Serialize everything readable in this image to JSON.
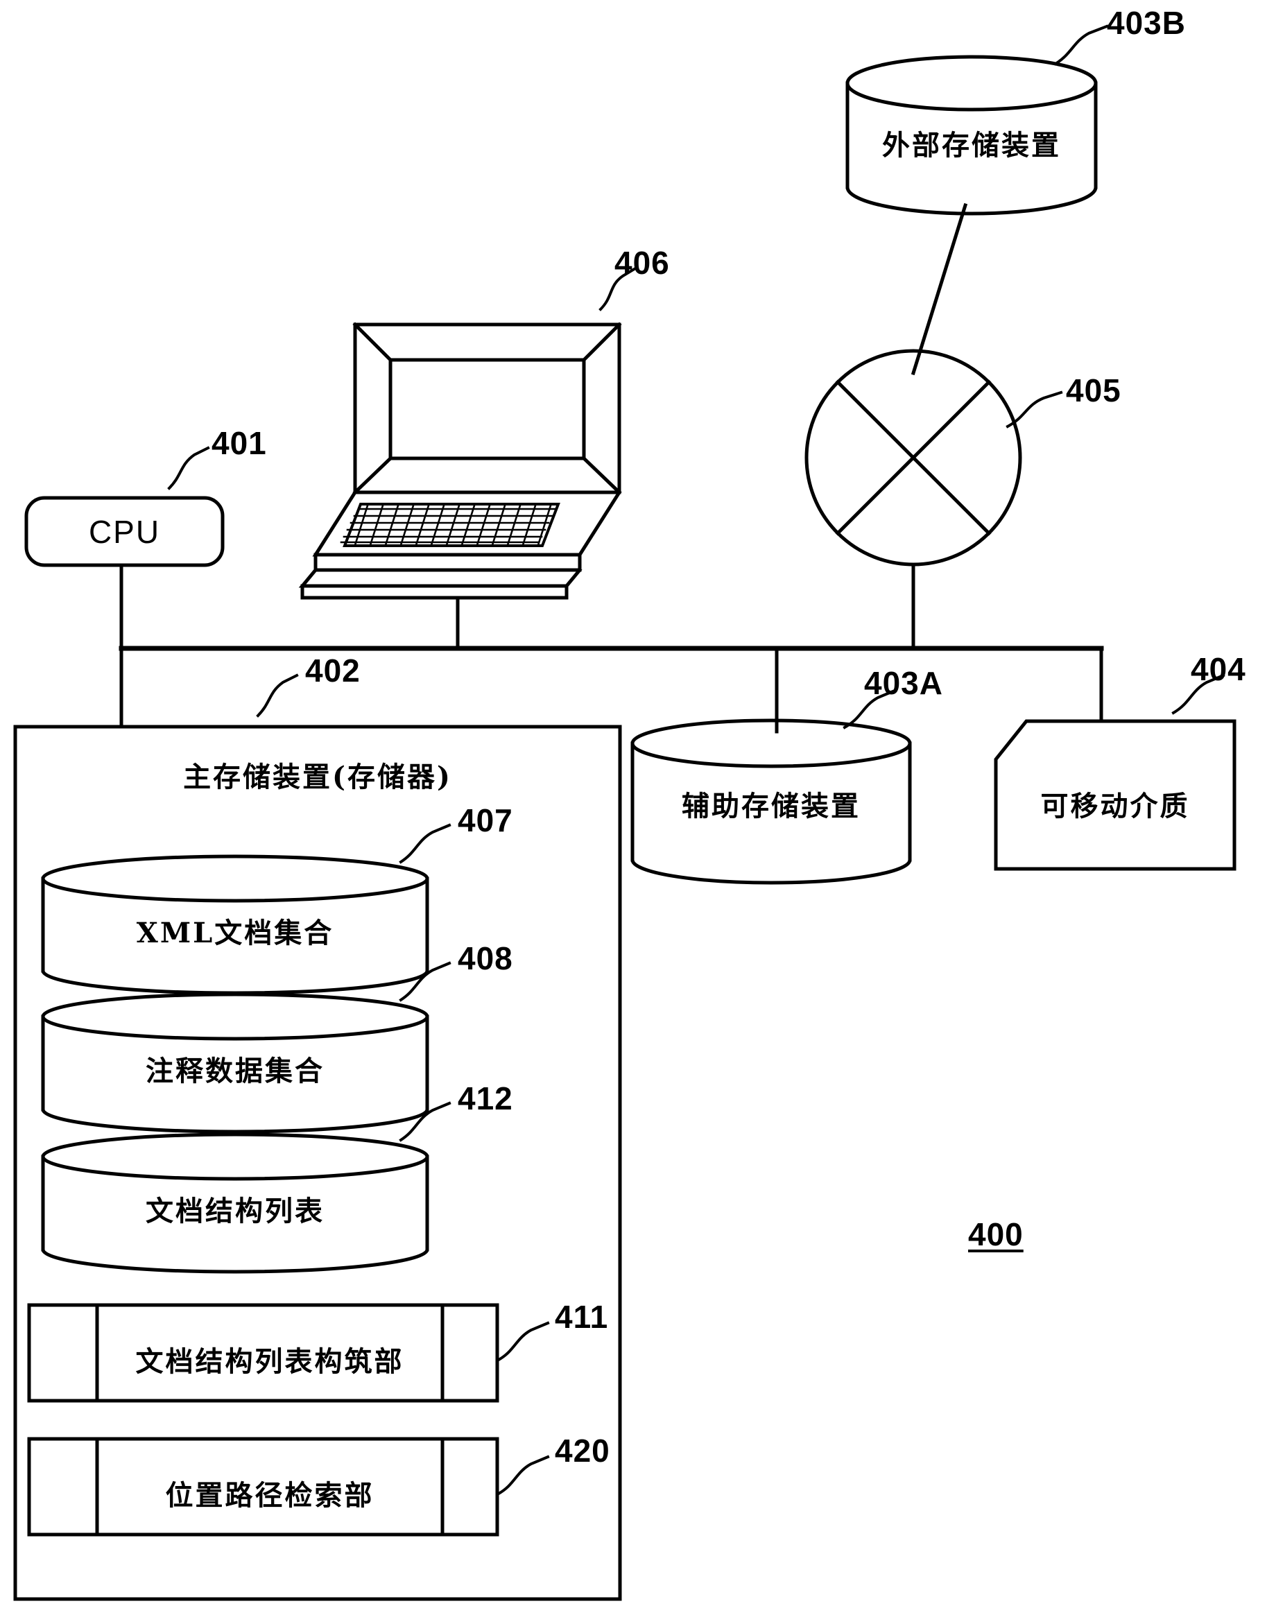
{
  "figure": {
    "number": "400",
    "title_note": "System configuration block diagram"
  },
  "components": {
    "cpu": {
      "label": "CPU",
      "ref": "401"
    },
    "laptop": {
      "ref": "406",
      "icon": "laptop-computer-icon"
    },
    "network": {
      "ref": "405",
      "icon": "circle-x-network-icon"
    },
    "external_storage": {
      "label": "外部存储装置",
      "ref": "403B",
      "icon": "cylinder-database-icon"
    },
    "main_storage": {
      "label": "主存储装置(存储器)",
      "ref": "402"
    },
    "auxiliary_storage": {
      "label": "辅助存储装置",
      "ref": "403A",
      "icon": "cylinder-database-icon"
    },
    "removable_media": {
      "label": "可移动介质",
      "ref": "404",
      "icon": "cut-corner-media-icon"
    }
  },
  "main_storage_contents": {
    "cylinders": [
      {
        "label": "XML文档集合",
        "ref": "407"
      },
      {
        "label": "注释数据集合",
        "ref": "408"
      },
      {
        "label": "文档结构列表",
        "ref": "412"
      }
    ],
    "modules": [
      {
        "label": "文档结构列表构筑部",
        "ref": "411"
      },
      {
        "label": "位置路径检索部",
        "ref": "420"
      }
    ]
  },
  "style": {
    "line_color": "#000000",
    "background": "#ffffff"
  }
}
